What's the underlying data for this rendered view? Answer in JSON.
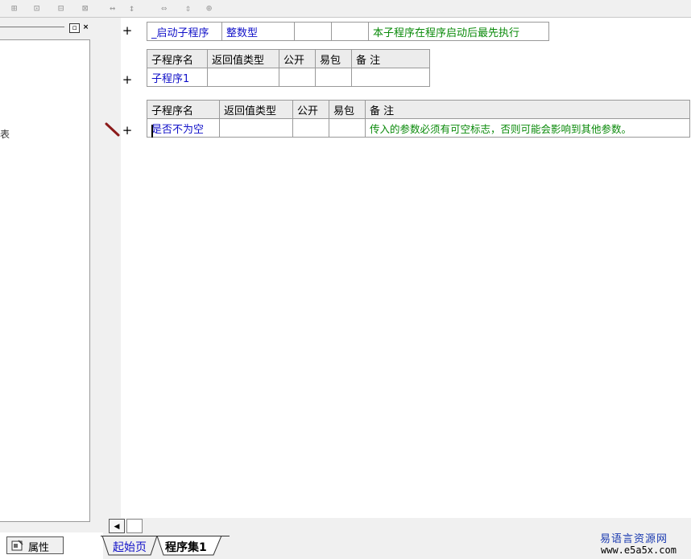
{
  "toolbar": {
    "icons": [
      "align-left-icon",
      "align-center-icon",
      "align-top-icon",
      "align-middle-icon",
      "distribute-h-icon",
      "distribute-v-icon",
      "same-width-icon",
      "same-height-icon",
      "same-size-icon"
    ],
    "glyphs": [
      "⊞",
      "⊡",
      "⊟",
      "⊠",
      "↔",
      "↕",
      "⇔",
      "⇕",
      "⊕"
    ]
  },
  "left_panel": {
    "close_glyph": "×",
    "restore_glyph": "▫",
    "cut_text": "表",
    "bottom_tab_label": "属性"
  },
  "code": {
    "plus": "+",
    "startup_row": {
      "name": "_启动子程序",
      "return_type": "整数型",
      "public": "",
      "easy_pack": "",
      "remark": "本子程序在程序启动后最先执行"
    },
    "table1": {
      "headers": [
        "子程序名",
        "返回值类型",
        "公开",
        "易包",
        "备 注"
      ],
      "row": [
        "子程序1",
        "",
        "",
        "",
        ""
      ]
    },
    "table2": {
      "headers": [
        "子程序名",
        "返回值类型",
        "公开",
        "易包",
        "备 注"
      ],
      "row": [
        "是否不为空",
        "",
        "",
        "",
        "传入的参数必须有可空标志，否则可能会影响到其他参数。"
      ]
    }
  },
  "tabs": [
    "起始页",
    "程序集1"
  ],
  "scroll_left_glyph": "◀",
  "watermark": {
    "cn": "易语言资源网",
    "url": "www.e5a5x.com"
  },
  "colors": {
    "blue_text": "#1010c8",
    "green_text": "#0a8a0a",
    "pencil": "#8b1a1a"
  }
}
